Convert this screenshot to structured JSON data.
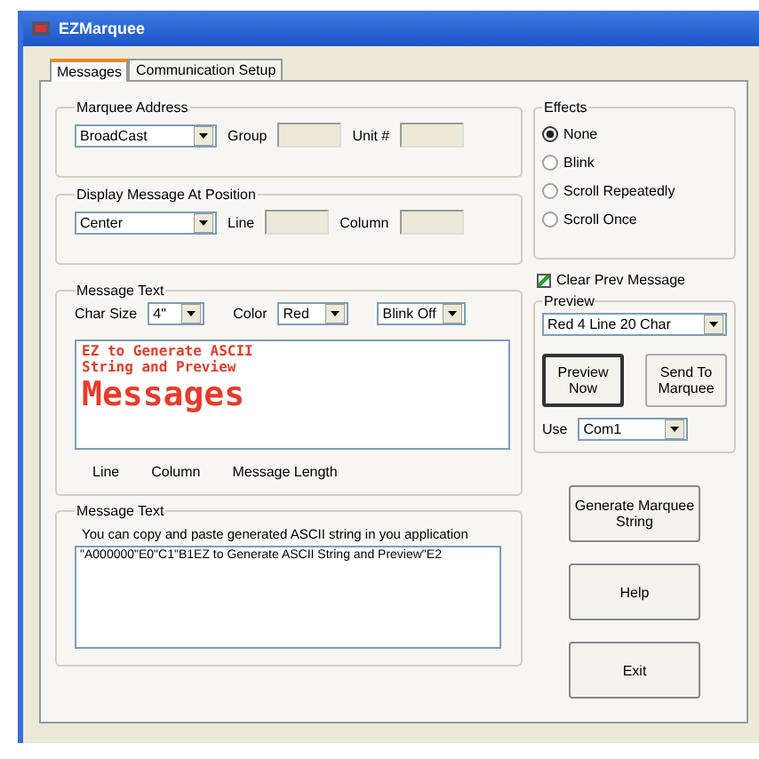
{
  "window": {
    "title": "EZMarquee"
  },
  "tabs": [
    {
      "label": "Messages",
      "selected": true
    },
    {
      "label": "Communication Setup",
      "selected": false
    }
  ],
  "marquee_address": {
    "title": "Marquee Address",
    "address": "BroadCast",
    "fields": [
      {
        "label": "Group",
        "disabled": true
      },
      {
        "label": "Unit #",
        "disabled": true
      }
    ]
  },
  "position": {
    "title": "Display Message At Position",
    "align": "Center",
    "fields": [
      {
        "label": "Line",
        "disabled": true
      },
      {
        "label": "Column",
        "disabled": true
      }
    ]
  },
  "message_text": {
    "title": "Message Text",
    "char_size_label": "Char Size",
    "char_size": "4\"",
    "color_label": "Color",
    "color_value": "Red",
    "blink": "Blink Off",
    "lines": [
      {
        "text": "EZ to Generate ASCII",
        "kind": "small"
      },
      {
        "text": "String and Preview",
        "kind": "small"
      },
      {
        "text": "Messages",
        "kind": "large"
      }
    ],
    "status": [
      "Line",
      "Column",
      "Message Length"
    ]
  },
  "output": {
    "title": "Message Text",
    "hint": "You can copy and paste generated ASCII string in you application",
    "value": "\"A000000\"E0\"C1\"B1EZ to Generate ASCII String and Preview\"E2"
  },
  "effects": {
    "title": "Effects",
    "options": [
      {
        "label": "None",
        "selected": true
      },
      {
        "label": "Blink",
        "selected": false
      },
      {
        "label": "Scroll Repeatedly",
        "selected": false
      },
      {
        "label": "Scroll Once",
        "selected": false
      }
    ]
  },
  "clear_prev": {
    "label": "Clear Prev Message",
    "checked": true
  },
  "preview": {
    "title": "Preview",
    "display": "Red 4 Line 20 Char",
    "buttons": [
      {
        "label": "Preview Now",
        "default": true
      },
      {
        "label": "Send To Marquee",
        "default": false
      }
    ],
    "port_label": "Use",
    "port": "Com1"
  },
  "actions": [
    {
      "label": "Generate Marquee String"
    },
    {
      "label": "Help"
    },
    {
      "label": "Exit"
    }
  ]
}
